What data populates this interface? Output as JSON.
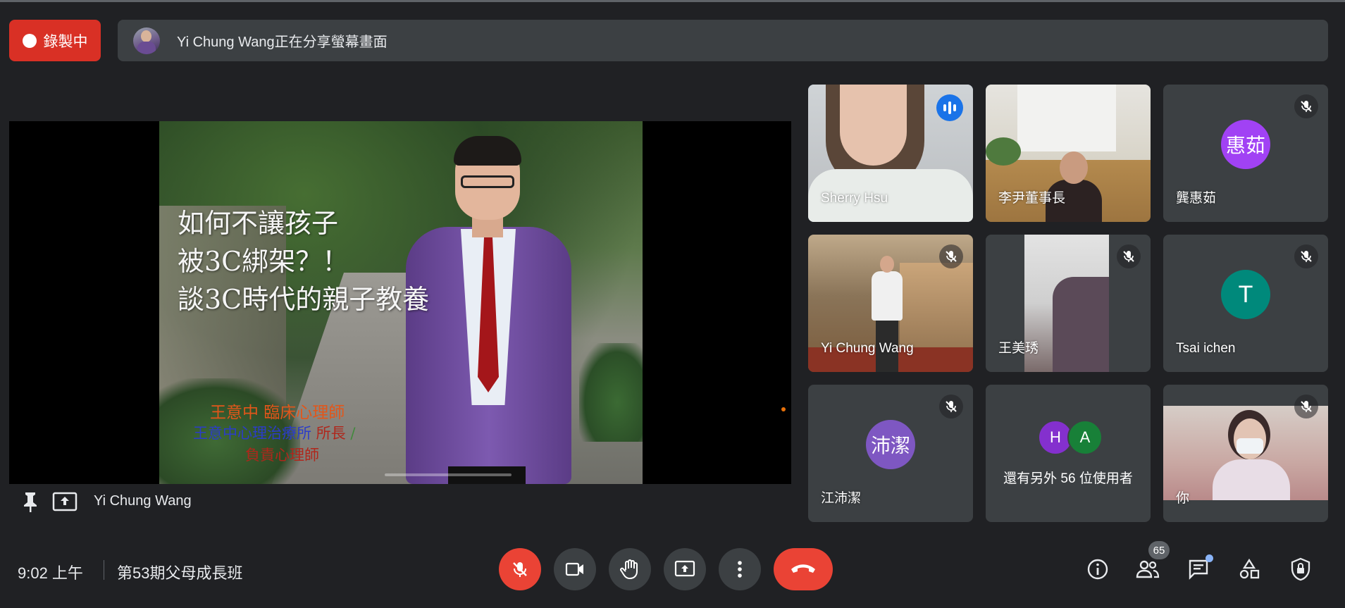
{
  "recording": {
    "label": "錄製中"
  },
  "share_banner": {
    "text": "Yi Chung Wang正在分享螢幕畫面"
  },
  "slide": {
    "title_lines": [
      "如何不讓孩子",
      "被3C綁架？！",
      "談3C時代的親子教養"
    ],
    "credit_line1": "王意中 臨床心理師",
    "credit_line2_a": "王意中心理治療所",
    "credit_line2_b": " 所長",
    "credit_line2_c": " /",
    "credit_line3": "負責心理師"
  },
  "presenter": {
    "name": "Yi Chung Wang"
  },
  "participants": [
    {
      "name": "Sherry Hsu",
      "speaking": true
    },
    {
      "name": "李尹董事長"
    },
    {
      "name": "龔惠茹",
      "initials": "惠茹",
      "avatar_color": "#a142f4"
    },
    {
      "name": "Yi Chung Wang"
    },
    {
      "name": "王美琇"
    },
    {
      "name": "Tsai ichen",
      "initials": "T",
      "avatar_color": "#00897b"
    },
    {
      "name": "江沛潔",
      "initials": "沛潔",
      "avatar_color": "#7e57c2"
    },
    {
      "name": "你"
    }
  ],
  "others": {
    "label": "還有另外 56 位使用者",
    "avatars": [
      {
        "letter": "H",
        "color": "#8430ce"
      },
      {
        "letter": "A",
        "color": "#188038"
      }
    ]
  },
  "footer": {
    "time": "9:02 上午",
    "meeting_name": "第53期父母成長班",
    "participant_count": "65"
  },
  "colors": {
    "accent_red": "#ea4335",
    "accent_blue": "#8ab4f8",
    "bar_bg": "#3c4043",
    "page_bg": "#202124"
  }
}
